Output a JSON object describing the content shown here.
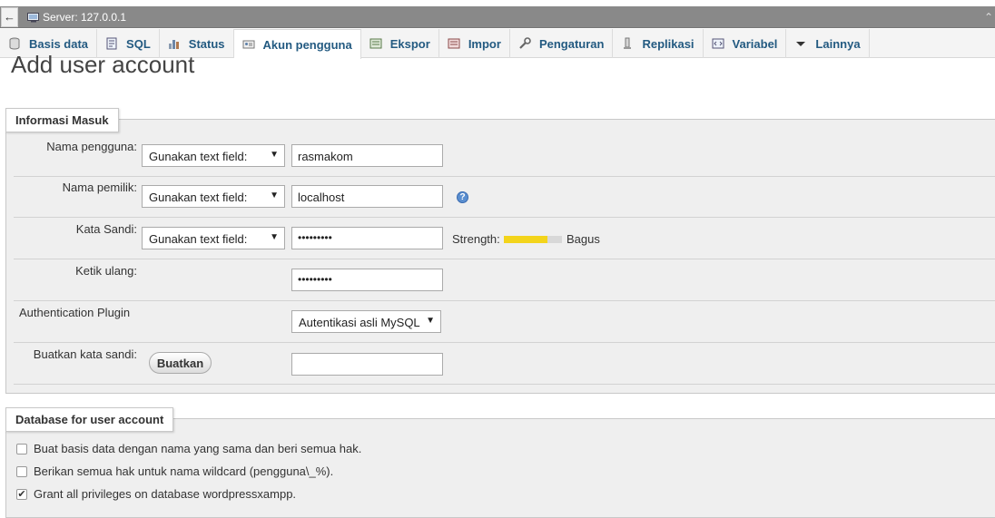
{
  "server_bar": {
    "back_glyph": "←",
    "title": "Server: 127.0.0.1",
    "collapse_glyph": "⌃"
  },
  "tabs": [
    {
      "label": "Basis data",
      "icon": "database-icon",
      "active": false
    },
    {
      "label": "SQL",
      "icon": "sql-icon",
      "active": false
    },
    {
      "label": "Status",
      "icon": "status-icon",
      "active": false
    },
    {
      "label": "Akun pengguna",
      "icon": "user-accounts-icon",
      "active": true
    },
    {
      "label": "Ekspor",
      "icon": "export-icon",
      "active": false
    },
    {
      "label": "Impor",
      "icon": "import-icon",
      "active": false
    },
    {
      "label": "Pengaturan",
      "icon": "wrench-icon",
      "active": false
    },
    {
      "label": "Replikasi",
      "icon": "replication-icon",
      "active": false
    },
    {
      "label": "Variabel",
      "icon": "variables-icon",
      "active": false
    },
    {
      "label": "Lainnya",
      "icon": "chevron-down-icon",
      "active": false
    }
  ],
  "page_title": "Add user account",
  "login_info": {
    "legend": "Informasi Masuk",
    "username": {
      "label": "Nama pengguna:",
      "mode": "Gunakan text field:",
      "value": "rasmakom"
    },
    "host": {
      "label": "Nama pemilik:",
      "mode": "Gunakan text field:",
      "value": "localhost"
    },
    "password": {
      "label": "Kata Sandi:",
      "mode": "Gunakan text field:",
      "value": "•••••••••",
      "strength_label": "Strength:",
      "strength_text": "Bagus",
      "strength_fraction": 0.75
    },
    "retype": {
      "label": "Ketik ulang:",
      "value": "•••••••••"
    },
    "auth_plugin": {
      "label": "Authentication Plugin",
      "value": "Autentikasi asli MySQL"
    },
    "generate": {
      "label": "Buatkan kata sandi:",
      "button": "Buatkan",
      "value": ""
    }
  },
  "database_section": {
    "legend": "Database for user account",
    "options": [
      {
        "label": "Buat basis data dengan nama yang sama dan beri semua hak.",
        "checked": false
      },
      {
        "label": "Berikan semua hak untuk nama wildcard (pengguna\\_%).",
        "checked": false
      },
      {
        "label": "Grant all privileges on database wordpressxampp.",
        "checked": true
      }
    ]
  },
  "colors": {
    "tab_text": "#235a81",
    "server_bar": "#898989",
    "strength_fill": "#f3d41b"
  }
}
